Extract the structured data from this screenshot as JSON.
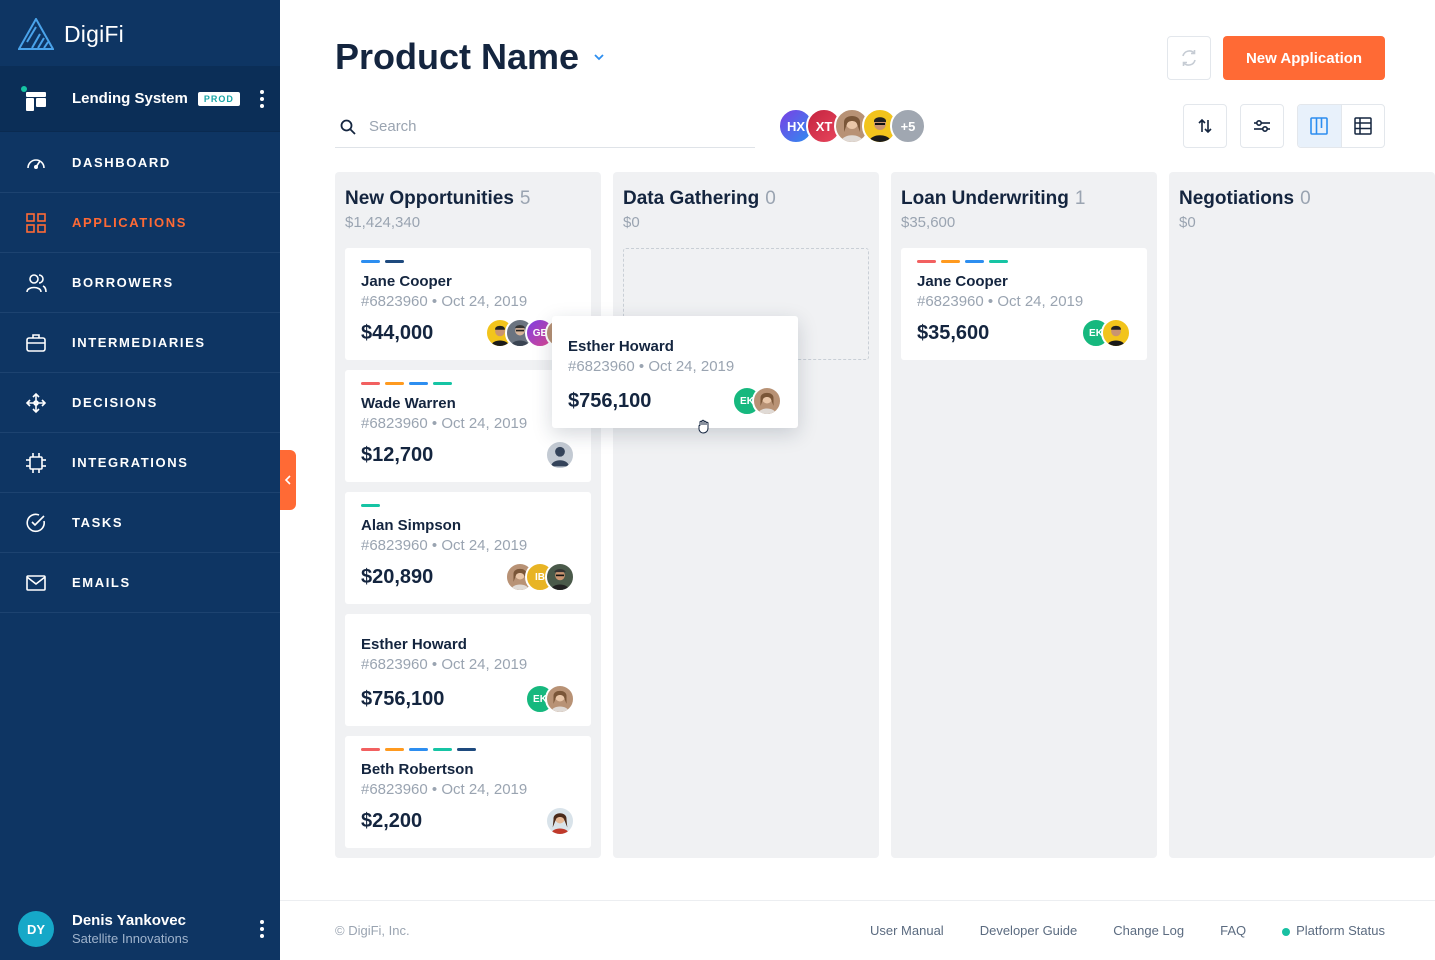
{
  "app": {
    "logo_text": "DigiFi"
  },
  "system": {
    "name": "Lending System",
    "badge": "PROD"
  },
  "nav": [
    {
      "label": "DASHBOARD",
      "icon": "gauge-icon"
    },
    {
      "label": "APPLICATIONS",
      "icon": "grid-icon",
      "active": true
    },
    {
      "label": "BORROWERS",
      "icon": "users-icon"
    },
    {
      "label": "INTERMEDIARIES",
      "icon": "briefcase-icon"
    },
    {
      "label": "DECISIONS",
      "icon": "decision-arrows-icon"
    },
    {
      "label": "INTEGRATIONS",
      "icon": "chip-icon"
    },
    {
      "label": "TASKS",
      "icon": "check-circle-icon"
    },
    {
      "label": "EMAILS",
      "icon": "mail-icon"
    }
  ],
  "user": {
    "initials": "DY",
    "name": "Denis Yankovec",
    "org": "Satellite Innovations"
  },
  "header": {
    "title": "Product Name",
    "new_application": "New Application"
  },
  "search": {
    "placeholder": "Search",
    "value": ""
  },
  "team": {
    "members": [
      "HX",
      "XT",
      "",
      "",
      "+5"
    ]
  },
  "columns": [
    {
      "title": "New Opportunities",
      "count": "5",
      "total": "$1,424,340"
    },
    {
      "title": "Data Gathering",
      "count": "0",
      "total": "$0"
    },
    {
      "title": "Loan Underwriting",
      "count": "1",
      "total": "$35,600"
    },
    {
      "title": "Negotiations",
      "count": "0",
      "total": "$0"
    }
  ],
  "cards": [
    {
      "name": "Jane Cooper",
      "meta": "#6823960 • Oct 24, 2019",
      "amount": "$44,000",
      "avatar_labels": [
        "",
        "",
        "GE",
        ""
      ]
    },
    {
      "name": "Wade Warren",
      "meta": "#6823960 • Oct 24, 2019",
      "amount": "$12,700"
    },
    {
      "name": "Alan Simpson",
      "meta": "#6823960 • Oct 24, 2019",
      "amount": "$20,890",
      "avatar_labels": [
        "",
        "IB",
        ""
      ]
    },
    {
      "name": "Esther Howard",
      "meta": "#6823960 • Oct 24, 2019",
      "amount": "$756,100",
      "avatar_labels": [
        "EK",
        ""
      ]
    },
    {
      "name": "Beth Robertson",
      "meta": "#6823960 • Oct 24, 2019",
      "amount": "$2,200"
    },
    {
      "name": "Jane Cooper",
      "meta": "#6823960 • Oct 24, 2019",
      "amount": "$35,600",
      "avatar_labels": [
        "EK",
        ""
      ]
    }
  ],
  "dragging_card": {
    "name": "Esther Howard",
    "meta": "#6823960 • Oct 24, 2019",
    "amount": "$756,100",
    "avatar_labels": [
      "EK",
      ""
    ]
  },
  "tag_colors": {
    "red": "#f26060",
    "orange": "#ff9a1f",
    "blue": "#2d8ef0",
    "teal": "#16c4a4",
    "navy": "#1e4a7e"
  },
  "colors": {
    "accent": "#ff6a35",
    "sidebar": "#0e3563"
  },
  "footer": {
    "copyright": "© DigiFi, Inc.",
    "links": [
      "User Manual",
      "Developer Guide",
      "Change Log",
      "FAQ",
      "Platform Status"
    ]
  }
}
